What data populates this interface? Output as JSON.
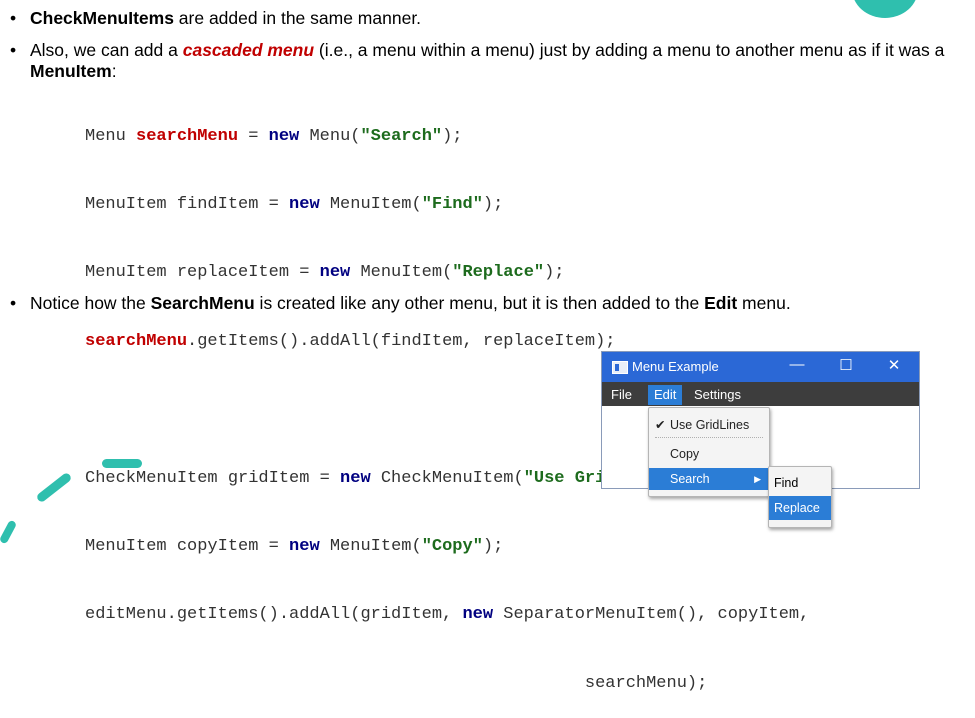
{
  "bullets": {
    "b1": {
      "bold": "CheckMenuItems",
      "rest": " are added in the same manner."
    },
    "b2": {
      "pre": "Also, we can add a ",
      "emph": "cascaded menu",
      "mid": " (i.e., a menu within a menu) just by adding a menu to another menu as if it was a ",
      "bold": "MenuItem",
      "post": ":"
    },
    "b3": {
      "pre": "Notice how the ",
      "bold1": "SearchMenu",
      "mid": " is created like any other menu, but it is then added to the ",
      "bold2": "Edit",
      "post": " menu."
    },
    "dot": "•"
  },
  "code": {
    "l1": [
      "Menu ",
      "searchMenu",
      " = ",
      "new",
      " Menu(",
      "\"Search\"",
      ");"
    ],
    "l2": [
      "MenuItem findItem = ",
      "new",
      " MenuItem(",
      "\"Find\"",
      ");"
    ],
    "l3": [
      "MenuItem replaceItem = ",
      "new",
      " MenuItem(",
      "\"Replace\"",
      ");"
    ],
    "l4": [
      "searchMenu",
      ".getItems().addAll(findItem, replaceItem);"
    ],
    "l6": [
      "CheckMenuItem gridItem = ",
      "new",
      " CheckMenuItem(",
      "\"Use GridLines\"",
      ");"
    ],
    "l7": [
      "MenuItem copyItem = ",
      "new",
      " MenuItem(",
      "\"Copy\"",
      ");"
    ],
    "l8": [
      "editMenu.getItems().addAll(gridItem, ",
      "new",
      " SeparatorMenuItem(), copyItem,"
    ],
    "l9": [
      "                                                 searchMenu);"
    ]
  },
  "window": {
    "title": "Menu Example",
    "minimize": "—",
    "maximize": "☐",
    "close": "✕",
    "menus": [
      "File",
      "Edit",
      "Settings"
    ],
    "dropdown": {
      "check_mark": "✔",
      "items": [
        "Use GridLines",
        "Copy",
        "Search"
      ],
      "submenu_arrow": "▶"
    },
    "submenu": [
      "Find",
      "Replace"
    ]
  },
  "colors": {
    "accent": "#2fbfae",
    "titlebar": "#2b68d6",
    "selection": "#2b7dd6",
    "keyword_red": "#c00000",
    "string_green": "#1d6b1d"
  }
}
